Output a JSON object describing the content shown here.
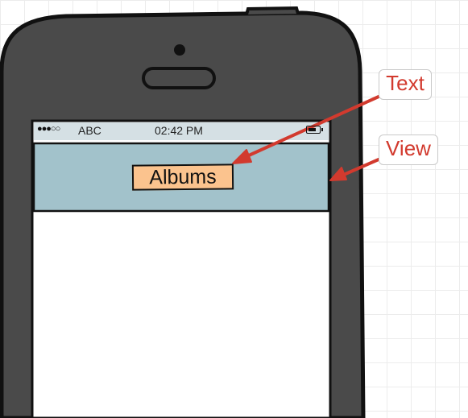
{
  "status_bar": {
    "signal": "●●●○○",
    "carrier": "ABC",
    "time": "02:42 PM",
    "battery_icon": "battery-icon"
  },
  "nav_bar": {
    "title": "Albums"
  },
  "annotations": {
    "text_label": "Text",
    "view_label": "View"
  },
  "colors": {
    "phone_body": "#4a4a4a",
    "screen": "#ffffff",
    "status_bar": "#d5e0e4",
    "nav_bar": "#a2c2cb",
    "title_box": "#fbc38e",
    "annotation": "#d23a2e"
  }
}
